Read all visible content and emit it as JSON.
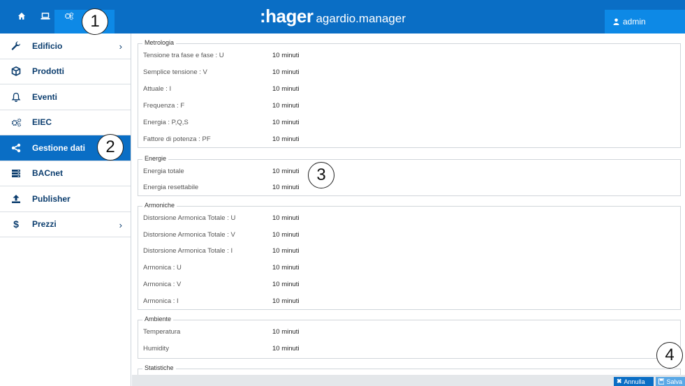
{
  "header": {
    "brand_mark": ":hager",
    "product": "agardio.manager",
    "user": "admin"
  },
  "sidebar": {
    "items": [
      {
        "label": "Edificio",
        "icon": "wrench-icon",
        "has_chevron": true
      },
      {
        "label": "Prodotti",
        "icon": "box-icon",
        "has_chevron": false
      },
      {
        "label": "Eventi",
        "icon": "bell-icon",
        "has_chevron": false
      },
      {
        "label": "EIEC",
        "icon": "gears-icon",
        "has_chevron": false
      },
      {
        "label": "Gestione dati",
        "icon": "share-icon",
        "has_chevron": false,
        "active": true
      },
      {
        "label": "BACnet",
        "icon": "server-icon",
        "has_chevron": false
      },
      {
        "label": "Publisher",
        "icon": "upload-icon",
        "has_chevron": false
      },
      {
        "label": "Prezzi",
        "icon": "dollar-icon",
        "has_chevron": true
      }
    ]
  },
  "callouts": [
    "1",
    "2",
    "3",
    "4"
  ],
  "sections": [
    {
      "legend": "Metrologia",
      "rows": [
        {
          "label": "Tensione tra fase e fase : U",
          "value": "10 minuti"
        },
        {
          "label": "Semplice tensione : V",
          "value": "10 minuti"
        },
        {
          "label": "Attuale : I",
          "value": "10 minuti"
        },
        {
          "label": "Frequenza : F",
          "value": "10 minuti"
        },
        {
          "label": "Energia : P,Q,S",
          "value": "10 minuti"
        },
        {
          "label": "Fattore di potenza : PF",
          "value": "10 minuti"
        }
      ]
    },
    {
      "legend": "Energie",
      "rows": [
        {
          "label": "Energia totale",
          "value": "10 minuti"
        },
        {
          "label": "Energia resettabile",
          "value": "10 minuti"
        }
      ]
    },
    {
      "legend": "Armoniche",
      "rows": [
        {
          "label": "Distorsione Armonica Totale : U",
          "value": "10 minuti"
        },
        {
          "label": "Distorsione Armonica Totale : V",
          "value": "10 minuti"
        },
        {
          "label": "Distorsione Armonica Totale : I",
          "value": "10 minuti"
        },
        {
          "label": "Armonica : U",
          "value": "10 minuti"
        },
        {
          "label": "Armonica : V",
          "value": "10 minuti"
        },
        {
          "label": "Armonica : I",
          "value": "10 minuti"
        }
      ]
    },
    {
      "legend": "Ambiente",
      "rows": [
        {
          "label": "Temperatura",
          "value": "10 minuti"
        },
        {
          "label": "Humidity",
          "value": "10 minuti"
        }
      ]
    },
    {
      "legend": "Statistiche",
      "rows": []
    }
  ],
  "footer": {
    "cancel_label": "Annulla",
    "save_label": "Salva"
  },
  "colors": {
    "primary": "#0a6ec5",
    "primary_light": "#0d89e6",
    "nav_text": "#0b3d6e"
  }
}
